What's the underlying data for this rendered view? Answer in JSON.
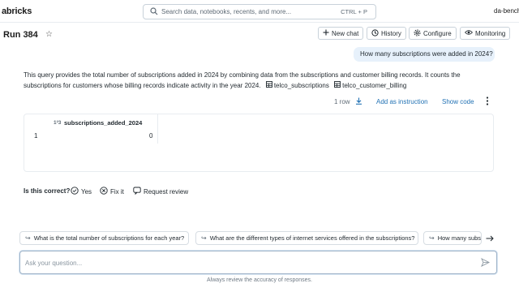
{
  "app": {
    "brand": "abricks",
    "workspace": "da-bench"
  },
  "search": {
    "placeholder": "Search data, notebooks, recents, and more...",
    "shortcut": "CTRL + P"
  },
  "header": {
    "title": "Run 384",
    "buttons": {
      "new_chat": "New chat",
      "history": "History",
      "configure": "Configure",
      "monitoring": "Monitoring"
    }
  },
  "conversation": {
    "user_message": "How many subscriptions were added in 2024?",
    "answer_text": "This query provides the total number of subscriptions added in 2024 by combining data from the subscriptions and customer billing records. It counts the subscriptions for customers whose billing records indicate activity in the year 2024.",
    "tables": [
      "telco_subscriptions",
      "telco_customer_billing"
    ]
  },
  "result": {
    "row_count": "1 row",
    "add_instruction": "Add as instruction",
    "show_code": "Show code",
    "column": "subscriptions_added_2024",
    "rows": [
      {
        "index": "1",
        "value": "0"
      }
    ]
  },
  "feedback": {
    "question": "Is this correct?",
    "yes": "Yes",
    "fix": "Fix it",
    "review": "Request review"
  },
  "suggestions": [
    "What is the total number of subscriptions for each year?",
    "What are the different types of internet services offered in the subscriptions?",
    "How many subs"
  ],
  "chat": {
    "placeholder": "Ask your question...",
    "disclaimer": "Always review the accuracy of responses."
  },
  "colors": {
    "accent": "#2272b4",
    "user_bubble": "#e7f1fb",
    "border": "#c9d2da"
  }
}
